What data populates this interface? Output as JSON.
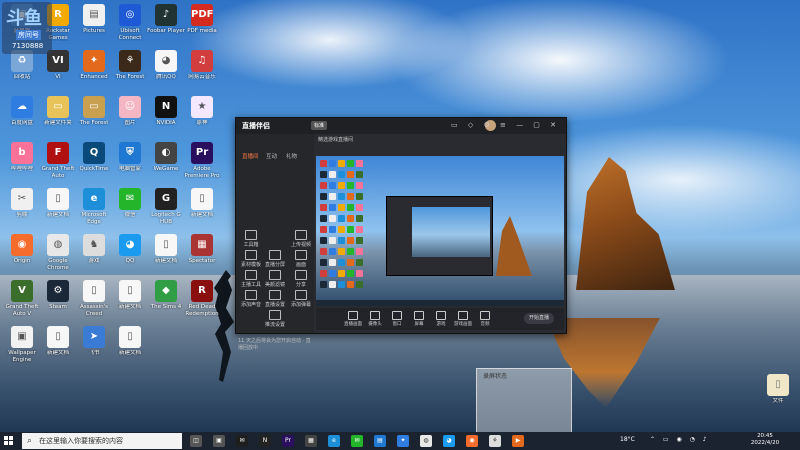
{
  "overlay": {
    "logo_text": "斗鱼",
    "room_label": "房间号",
    "room_number": "7130888"
  },
  "desktop_icons": [
    {
      "label": "此电脑",
      "color": "#4a90d9",
      "glyph": "▣"
    },
    {
      "label": "Rockstar Games Launcher",
      "color": "#f2a900",
      "glyph": "R"
    },
    {
      "label": "Pictures",
      "color": "#f0f0f0",
      "glyph": "▤"
    },
    {
      "label": "Ubisoft Connect",
      "color": "#1e5ad6",
      "glyph": "◎"
    },
    {
      "label": "Foobar Player",
      "color": "#233",
      "glyph": "♪"
    },
    {
      "label": "PDF media",
      "color": "#d52b1e",
      "glyph": "PDF"
    },
    {
      "label": "回收站",
      "color": "#7aa7d8",
      "glyph": "♻"
    },
    {
      "label": "VI",
      "color": "#333",
      "glyph": "VI"
    },
    {
      "label": "Enhanced",
      "color": "#e36a1c",
      "glyph": "✦"
    },
    {
      "label": "The Forest",
      "color": "#3b2a1a",
      "glyph": "⚘"
    },
    {
      "label": "腾讯QQ",
      "color": "#f6f6f6",
      "glyph": "◕"
    },
    {
      "label": "网易云音乐",
      "color": "#d23e3e",
      "glyph": "♫"
    },
    {
      "label": "百度网盘",
      "color": "#2f7de1",
      "glyph": "☁"
    },
    {
      "label": "新建文件夹",
      "color": "#e8c35a",
      "glyph": "▭"
    },
    {
      "label": "The Forest",
      "color": "#c9a050",
      "glyph": "▭"
    },
    {
      "label": "图片",
      "color": "#f4b6c2",
      "glyph": "☺"
    },
    {
      "label": "NVIDIA",
      "color": "#111",
      "glyph": "N"
    },
    {
      "label": "原神",
      "color": "#f3e8ff",
      "glyph": "★"
    },
    {
      "label": "哔哩哔哩",
      "color": "#fb7299",
      "glyph": "b"
    },
    {
      "label": "Grand Theft Auto",
      "color": "#b01010",
      "glyph": "F"
    },
    {
      "label": "QuickTime",
      "color": "#0a4a7a",
      "glyph": "Q"
    },
    {
      "label": "电脑管家",
      "color": "#1f78d1",
      "glyph": "⛨"
    },
    {
      "label": "WeGame",
      "color": "#444",
      "glyph": "◐"
    },
    {
      "label": "Adobe Premiere Pro",
      "color": "#2a0f5e",
      "glyph": "Pr"
    },
    {
      "label": "剪映",
      "color": "#f0f0f0",
      "glyph": "✂"
    },
    {
      "label": "新建文档",
      "color": "#f7f7f7",
      "glyph": "▯"
    },
    {
      "label": "Microsoft Edge",
      "color": "#1d8fd8",
      "glyph": "e"
    },
    {
      "label": "微信",
      "color": "#24b52b",
      "glyph": "✉"
    },
    {
      "label": "Logitech G HUB",
      "color": "#222",
      "glyph": "G"
    },
    {
      "label": "新建文档",
      "color": "#f7f7f7",
      "glyph": "▯"
    },
    {
      "label": "Origin",
      "color": "#f56c2d",
      "glyph": "◉"
    },
    {
      "label": "Google Chrome",
      "color": "#e8e8e8",
      "glyph": "◍"
    },
    {
      "label": "游戏",
      "color": "#ddd",
      "glyph": "♞"
    },
    {
      "label": "QQ",
      "color": "#1a9bf0",
      "glyph": "◕"
    },
    {
      "label": "新建文档",
      "color": "#f7f7f7",
      "glyph": "▯"
    },
    {
      "label": "Spectator",
      "color": "#a33",
      "glyph": "▦"
    },
    {
      "label": "Grand Theft Auto V",
      "color": "#3a6e2a",
      "glyph": "V"
    },
    {
      "label": "Steam",
      "color": "#1b2838",
      "glyph": "⚙"
    },
    {
      "label": "Assassin's Creed",
      "color": "#f7f7f7",
      "glyph": "▯"
    },
    {
      "label": "新建文档",
      "color": "#f7f7f7",
      "glyph": "▯"
    },
    {
      "label": "The Sims 4",
      "color": "#2f9e44",
      "glyph": "◆"
    },
    {
      "label": "Red Dead Redemption",
      "color": "#8a1010",
      "glyph": "R"
    },
    {
      "label": "Wallpaper Engine",
      "color": "#f2f2f2",
      "glyph": "▣"
    },
    {
      "label": "新建文档",
      "color": "#f7f7f7",
      "glyph": "▯"
    },
    {
      "label": "飞书",
      "color": "#3a7bd5",
      "glyph": "➤"
    },
    {
      "label": "新建文档",
      "color": "#f7f7f7",
      "glyph": "▯"
    }
  ],
  "right_icon": {
    "label": "文件",
    "color": "#f0e6c8",
    "glyph": "▯"
  },
  "app": {
    "title": "直播伴侣",
    "badge": "标准",
    "controls": "▭ ◇ ⚙ ≡ — ▢ ✕",
    "tabs": [
      "直播间",
      "互动",
      "礼物"
    ],
    "main_header": "精选游戏直播间",
    "side_items": [
      "工具箱",
      "素材模板",
      "直播分屏",
      "上传视频",
      "主播工具",
      "美颜滤镜",
      "分享",
      "画面",
      "添加声音",
      "直播设置",
      "添加弹幕",
      "推流设置"
    ],
    "footer": "11 天之后将会为您开启自动 · 直播回放中",
    "toolbar": [
      "直播画面",
      "摄像头",
      "窗口",
      "屏幕",
      "游戏",
      "游戏画面",
      "音频"
    ],
    "start_label": "开始直播"
  },
  "float_window": {
    "title": "录屏状态"
  },
  "taskbar": {
    "search_placeholder": "在这里输入你要搜索的内容",
    "weather": "18°C",
    "time": "20:45",
    "date": "2022/4/20"
  }
}
